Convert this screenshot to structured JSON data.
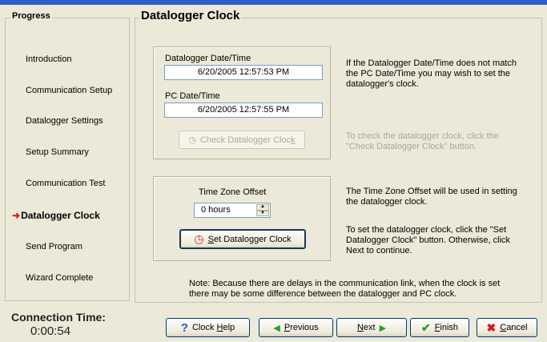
{
  "progress": {
    "title": "Progress",
    "steps": [
      "Introduction",
      "Communication Setup",
      "Datalogger Settings",
      "Setup Summary",
      "Communication Test",
      "Datalogger Clock",
      "Send Program",
      "Wizard Complete"
    ],
    "current_step": "Datalogger Clock"
  },
  "main": {
    "title": "Datalogger Clock",
    "datalogger_datetime_label": "Datalogger Date/Time",
    "datalogger_datetime_value": "6/20/2005 12:57:53 PM",
    "pc_datetime_label": "PC Date/Time",
    "pc_datetime_value": "6/20/2005 12:57:55 PM",
    "check_button": {
      "pre": "Check Datalogger Cloc",
      "key": "k"
    },
    "mismatch_text": "If the Datalogger Date/Time does not match the PC Date/Time you may wish to set the datalogger's clock.",
    "check_help_text": "To check the datalogger clock, click the \"Check Datalogger Clock\" button.",
    "tz_label": "Time Zone Offset",
    "tz_value": "0 hours",
    "set_button": {
      "key": "S",
      "post": "et Datalogger Clock"
    },
    "tz_help_text": "The Time Zone Offset will be used in setting the datalogger clock.",
    "set_help_text": "To set the datalogger clock, click the \"Set Datalogger Clock\" button.  Otherwise, click Next to continue.",
    "note_text": "Note: Because there are delays in the communication link, when the clock is set there may be some difference between the datalogger and PC clock."
  },
  "connection": {
    "label": "Connection Time:",
    "value": "0:00:54"
  },
  "footer": {
    "clock_help": {
      "pre": "Clock ",
      "key": "H",
      "post": "elp"
    },
    "previous": {
      "key": "P",
      "post": "revious"
    },
    "next": {
      "key": "N",
      "post": "ext"
    },
    "finish": {
      "key": "F",
      "post": "inish"
    },
    "cancel": {
      "key": "C",
      "post": "ancel"
    }
  },
  "colors": {
    "window_bg": "#ece9d8",
    "current_step_arrow": "#d81a1a",
    "disabled_text": "#aca899"
  }
}
